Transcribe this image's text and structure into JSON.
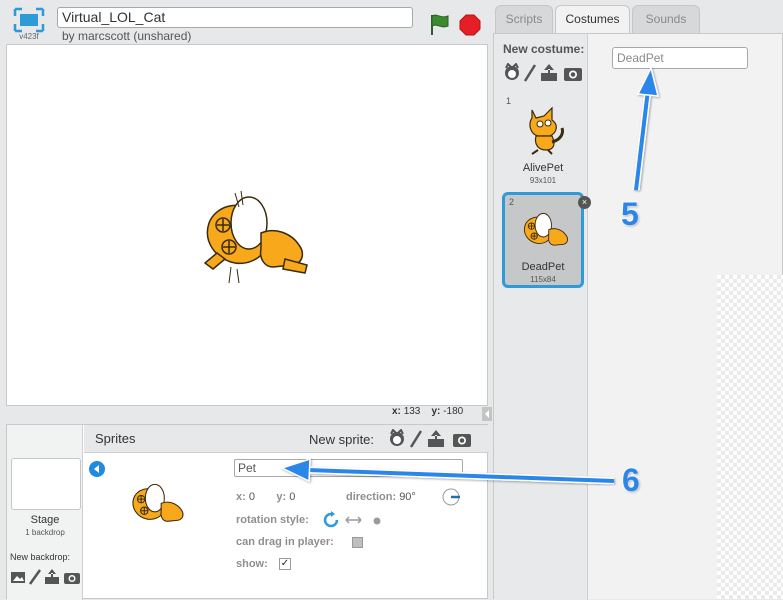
{
  "project": {
    "title": "Virtual_LOL_Cat",
    "author": "by marcscott (unshared)",
    "version": "v423f"
  },
  "stage": {
    "coords": {
      "x_label": "x:",
      "x_value": "133",
      "y_label": "y:",
      "y_value": "-180"
    }
  },
  "tabs": [
    {
      "label": "Scripts",
      "active": false
    },
    {
      "label": "Costumes",
      "active": true
    },
    {
      "label": "Sounds",
      "active": false
    }
  ],
  "costumes_panel": {
    "new_costume_label": "New costume:",
    "costume_name_value": "DeadPet",
    "costumes": [
      {
        "number": "1",
        "name": "AlivePet",
        "size": "93x101",
        "selected": false
      },
      {
        "number": "2",
        "name": "DeadPet",
        "size": "115x84",
        "selected": true
      }
    ]
  },
  "sprites_pane": {
    "sprites_label": "Sprites",
    "new_sprite_label": "New sprite:",
    "stage_label": "Stage",
    "stage_backdrops": "1 backdrop",
    "new_backdrop_label": "New backdrop:",
    "sprite_info": {
      "name_value": "Pet",
      "x_label": "x:",
      "x_value": "0",
      "y_label": "y:",
      "y_value": "0",
      "direction_label": "direction:",
      "direction_value": "90°",
      "rotation_style_label": "rotation style:",
      "can_drag_label": "can drag in player:",
      "show_label": "show:",
      "show_checked": true
    }
  },
  "annotations": [
    {
      "number": "5"
    },
    {
      "number": "6"
    }
  ],
  "colors": {
    "accent_blue": "#2e9ad7",
    "annotation_blue": "#2b86e8",
    "cat_orange": "#f7a91b",
    "stop_red": "#e41f26",
    "flag_green": "#3a8a2e"
  }
}
